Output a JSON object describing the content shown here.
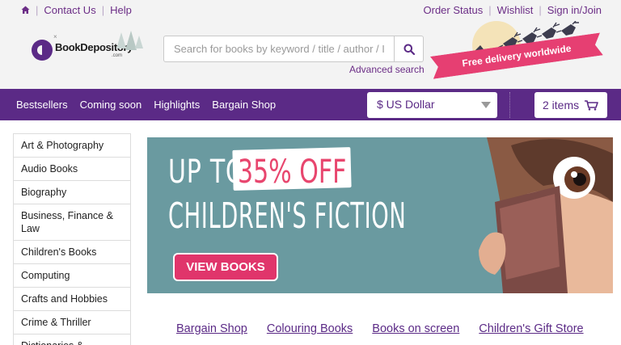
{
  "topbar": {
    "home_icon": "home-icon",
    "contact_us": "Contact Us",
    "help": "Help",
    "order_status": "Order Status",
    "wishlist": "Wishlist",
    "sign_in": "Sign in/Join"
  },
  "header": {
    "logo_text": "BookDepository",
    "logo_suffix": ".com",
    "search_placeholder": "Search for books by keyword / title / author / ISBN",
    "search_icon": "search-icon",
    "advanced_search": "Advanced search",
    "ribbon_text": "Free delivery worldwide"
  },
  "nav": {
    "links": [
      "Bestsellers",
      "Coming soon",
      "Highlights",
      "Bargain Shop"
    ],
    "currency": "$ US Dollar",
    "basket": "2 items",
    "basket_icon": "basket-icon"
  },
  "sidebar": {
    "categories": [
      "Art & Photography",
      "Audio Books",
      "Biography",
      "Business, Finance & Law",
      "Children's Books",
      "Computing",
      "Crafts and Hobbies",
      "Crime & Thriller",
      "Dictionaries &"
    ]
  },
  "banner": {
    "up_to": "UP TO",
    "discount": "35% OFF",
    "subject": "CHILDREN'S FICTION",
    "button": "VIEW BOOKS"
  },
  "promo_links": [
    "Bargain Shop",
    "Colouring Books",
    "Books on screen",
    "Children's Gift Store"
  ],
  "colors": {
    "brand_purple": "#5b2a86",
    "accent_pink": "#e8466e",
    "banner_teal": "#6a9aa0"
  }
}
